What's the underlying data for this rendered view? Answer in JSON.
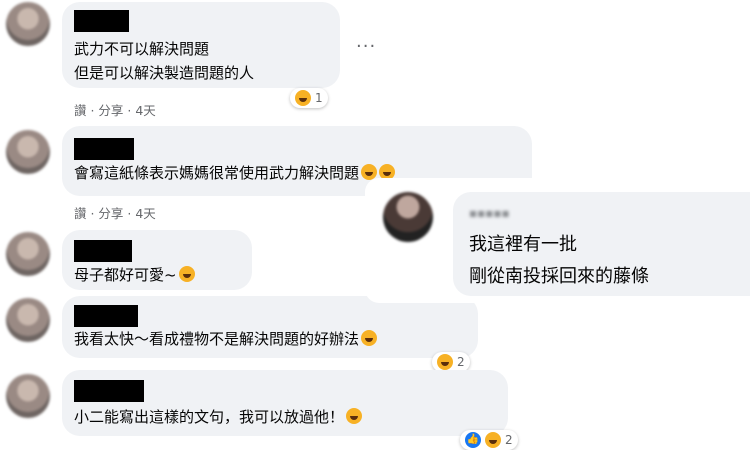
{
  "comments": [
    {
      "lines": [
        "武力不可以解決問題",
        "但是可以解決製造問題的人"
      ],
      "meta": "讚 · 分享 · 4天",
      "reaction_count": "1",
      "more": "···"
    },
    {
      "lines": [
        "會寫這紙條表示媽媽很常使用武力解決問題"
      ],
      "meta": "讚 · 分享 · 4天"
    },
    {
      "lines": [
        "母子都好可愛~"
      ]
    },
    {
      "lines": [
        "我看太快～看成禮物不是解決問題的好辦法"
      ],
      "reaction_count": "2"
    },
    {
      "lines": [
        "小二能寫出這樣的文句，我可以放過他！"
      ],
      "reaction_count": "2"
    }
  ],
  "overlay_comment": {
    "name": "▪▪▪▪▪",
    "lines": [
      "我這裡有一批",
      "剛從南投採回來的藤條"
    ]
  },
  "colors": {
    "bubble": "#f0f2f5",
    "meta": "#65676b",
    "like_blue": "#1877f2",
    "emoji_yellow": "#f7b125"
  },
  "icons": [
    "laughing-emoji-icon",
    "sad-emoji-icon",
    "grinning-emoji-icon",
    "like-icon",
    "more-options-icon"
  ]
}
